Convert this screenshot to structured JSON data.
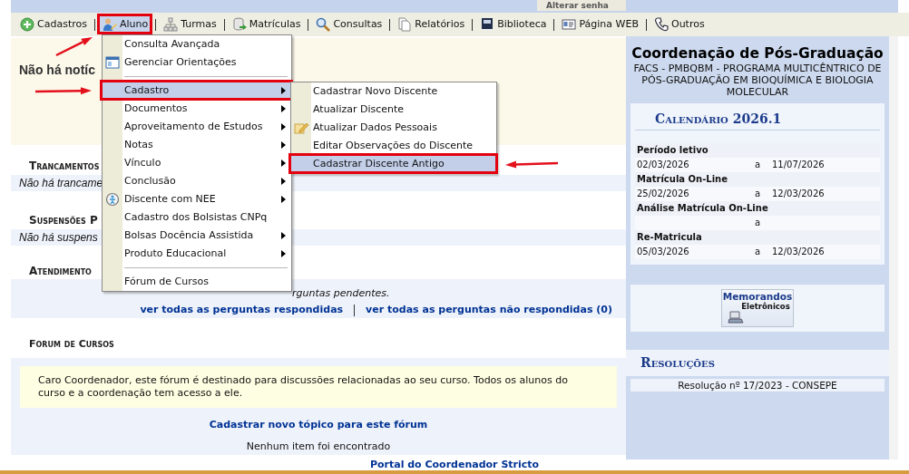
{
  "top_bar": {
    "link": "Alterar senha"
  },
  "menubar": [
    {
      "label": "Cadastros",
      "selected": false,
      "highlighted": false
    },
    {
      "label": "Aluno",
      "selected": true,
      "highlighted": true
    },
    {
      "label": "Turmas",
      "selected": false,
      "highlighted": false
    },
    {
      "label": "Matrículas",
      "selected": false,
      "highlighted": false
    },
    {
      "label": "Consultas",
      "selected": false,
      "highlighted": false
    },
    {
      "label": "Relatórios",
      "selected": false,
      "highlighted": false
    },
    {
      "label": "Biblioteca",
      "selected": false,
      "highlighted": false
    },
    {
      "label": "Página WEB",
      "selected": false,
      "highlighted": false
    },
    {
      "label": "Outros",
      "selected": false,
      "highlighted": false
    }
  ],
  "dropdown": {
    "items": [
      {
        "kind": "item",
        "label": "Consulta Avançada",
        "submenu": false,
        "selected": false,
        "highlighted": false
      },
      {
        "kind": "item",
        "label": "Gerenciar Orientações",
        "submenu": false,
        "selected": false,
        "highlighted": false
      },
      {
        "kind": "separator"
      },
      {
        "kind": "item",
        "label": "Cadastro",
        "submenu": true,
        "selected": true,
        "highlighted": true
      },
      {
        "kind": "item",
        "label": "Documentos",
        "submenu": true,
        "selected": false,
        "highlighted": false
      },
      {
        "kind": "item",
        "label": "Aproveitamento de Estudos",
        "submenu": true,
        "selected": false,
        "highlighted": false
      },
      {
        "kind": "item",
        "label": "Notas",
        "submenu": true,
        "selected": false,
        "highlighted": false
      },
      {
        "kind": "item",
        "label": "Vínculo",
        "submenu": true,
        "selected": false,
        "highlighted": false
      },
      {
        "kind": "item",
        "label": "Conclusão",
        "submenu": true,
        "selected": false,
        "highlighted": false
      },
      {
        "kind": "item",
        "label": "Discente com NEE",
        "submenu": true,
        "selected": false,
        "highlighted": false
      },
      {
        "kind": "item",
        "label": "Cadastro dos Bolsistas CNPq",
        "submenu": false,
        "selected": false,
        "highlighted": false
      },
      {
        "kind": "item",
        "label": "Bolsas Docência Assistida",
        "submenu": true,
        "selected": false,
        "highlighted": false
      },
      {
        "kind": "item",
        "label": "Produto Educacional",
        "submenu": true,
        "selected": false,
        "highlighted": false
      },
      {
        "kind": "separator"
      },
      {
        "kind": "item",
        "label": "Fórum de Cursos",
        "submenu": false,
        "selected": false,
        "highlighted": false
      }
    ]
  },
  "submenu": {
    "items": [
      {
        "kind": "item",
        "label": "Cadastrar Novo Discente",
        "selected": false,
        "highlighted": false
      },
      {
        "kind": "item",
        "label": "Atualizar Discente",
        "selected": false,
        "highlighted": false
      },
      {
        "kind": "item",
        "label": "Atualizar Dados Pessoais",
        "selected": false,
        "highlighted": false
      },
      {
        "kind": "item",
        "label": "Editar Observações do Discente",
        "selected": false,
        "highlighted": false
      },
      {
        "kind": "item",
        "label": "Cadastrar Discente Antigo",
        "selected": true,
        "highlighted": true
      }
    ]
  },
  "notice": {
    "text": "Não há notíc"
  },
  "sections": [
    {
      "heading": "Trancamentos",
      "row": "Não há trancame"
    },
    {
      "heading": "Suspensões P",
      "row": "Não há suspens"
    }
  ],
  "atendimento": {
    "heading": "Atendimento",
    "message": "rguntas pendentes.",
    "links": [
      "ver todas as perguntas respondidas",
      "ver todas as perguntas não respondidas (0)"
    ]
  },
  "forum": {
    "heading": "Forum de Cursos",
    "info": "Caro Coordenador, este fórum é destinado para discussões relacionadas ao seu curso. Todos os alunos do curso e a coordenação tem acesso a ele.",
    "link": "Cadastrar novo tópico para este fórum",
    "empty": "Nenhum item foi encontrado"
  },
  "footer": {
    "link": "Portal do Coordenador Stricto"
  },
  "sidebar": {
    "title": "Coordenação de Pós-Graduação",
    "subtitle": "FACS - PMBQBM - PROGRAMA MULTICÊNTRICO DE PÓS-GRADUAÇÃO EM BIOQUÍMICA E BIOLOGIA MOLECULAR",
    "calendar": {
      "title": "Calendário 2026.1",
      "periods": [
        {
          "label": "Período letivo",
          "start": "02/03/2026",
          "separator": "a",
          "end": "11/07/2026"
        },
        {
          "label": "Matrícula On-Line",
          "start": "25/02/2026",
          "separator": "a",
          "end": "12/03/2026"
        },
        {
          "label": "Análise Matrícula On-Line",
          "separator": "a"
        },
        {
          "label": "Re-Matricula",
          "start": "05/03/2026",
          "separator": "a",
          "end": "12/03/2026"
        }
      ]
    },
    "memorandos": {
      "lines": [
        "Memorandos",
        "Eletrônicos"
      ]
    },
    "resolucoes": {
      "title": "Resoluções",
      "items": [
        "Resolução nº 17/2023 - CONSEPE"
      ]
    }
  }
}
